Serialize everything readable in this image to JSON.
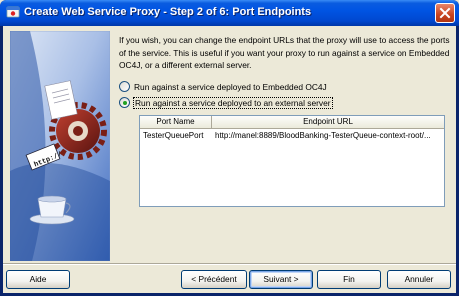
{
  "window": {
    "title": "Create Web Service Proxy - Step 2 of 6: Port Endpoints",
    "icon": "wizard-app-icon",
    "close_icon": "close-icon"
  },
  "content": {
    "intro_text": "If you wish, you can change the endpoint URLs that the proxy will use to access the ports of the service. This is useful if you want your proxy to run against a service on Embedded OC4J, or a different external server.",
    "radio_embedded_label": "Run against a service deployed to Embedded OC4J",
    "radio_external_label": "Run against a service deployed to an external server",
    "selected_option": "external"
  },
  "table": {
    "headers": [
      "Port Name",
      "Endpoint URL"
    ],
    "rows": [
      [
        "TesterQueuePort",
        "http://manel:8889/BloodBanking-TesterQueue-context-root/..."
      ]
    ]
  },
  "buttons": {
    "help": "Aide",
    "back": "< Précédent",
    "next": "Suivant >",
    "finish": "Fin",
    "cancel": "Annuler"
  },
  "colors": {
    "titlebar": "#0054e3",
    "dialog_bg": "#ece9d8",
    "panel_blue": "#4a78c8"
  }
}
